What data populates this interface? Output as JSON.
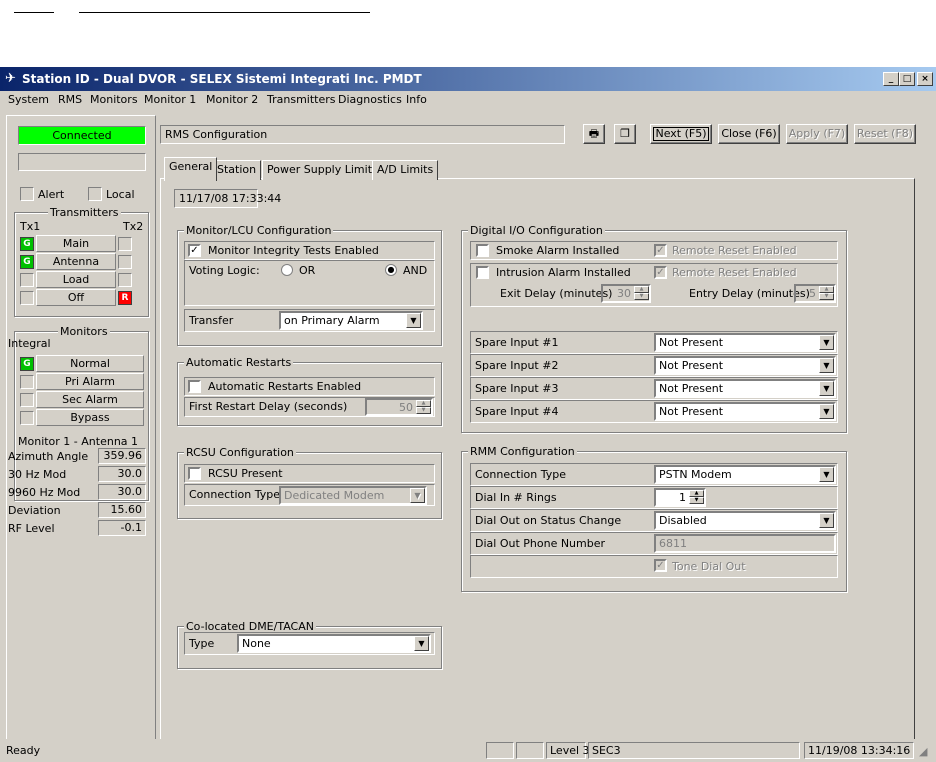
{
  "window": {
    "title": "Station ID - Dual DVOR - SELEX Sistemi Integrati Inc. PMDT",
    "menu": [
      "System",
      "RMS",
      "Monitors",
      "Monitor 1",
      "Monitor 2",
      "Transmitters",
      "Diagnostics",
      "Info"
    ]
  },
  "left": {
    "connection": "Connected",
    "alert": "Alert",
    "local": "Local",
    "transmitters": {
      "title": "Transmitters",
      "tx1": "Tx1",
      "tx2": "Tx2",
      "rows": [
        {
          "label": "Main",
          "tx1": "G",
          "tx2": ""
        },
        {
          "label": "Antenna",
          "tx1": "G",
          "tx2": ""
        },
        {
          "label": "Load",
          "tx1": "",
          "tx2": ""
        },
        {
          "label": "Off",
          "tx1": "",
          "tx2": "R"
        }
      ]
    },
    "monitors": {
      "title": "Monitors",
      "integral": "Integral",
      "rows": [
        {
          "label": "Normal",
          "ind": "G"
        },
        {
          "label": "Pri Alarm",
          "ind": ""
        },
        {
          "label": "Sec Alarm",
          "ind": ""
        },
        {
          "label": "Bypass",
          "ind": ""
        }
      ],
      "subtitle": "Monitor 1 - Antenna 1",
      "readings": [
        {
          "label": "Azimuth Angle",
          "value": "359.96"
        },
        {
          "label": "30 Hz Mod",
          "value": "30.0"
        },
        {
          "label": "9960 Hz Mod",
          "value": "30.0"
        },
        {
          "label": "Deviation",
          "value": "15.60"
        },
        {
          "label": "RF Level",
          "value": "-0.1"
        }
      ]
    }
  },
  "header": {
    "title": "RMS Configuration",
    "buttons": {
      "next": "Next (F5)",
      "close": "Close (F6)",
      "apply": "Apply (F7)",
      "reset": "Reset (F8)"
    }
  },
  "tabs": [
    "General",
    "Station",
    "Power Supply Limits",
    "A/D Limits"
  ],
  "timestamp": "11/17/08 17:33:44",
  "monitor_lcu": {
    "title": "Monitor/LCU Configuration",
    "integrity": "Monitor Integrity Tests Enabled",
    "voting": "Voting Logic:",
    "or": "OR",
    "and": "AND",
    "transfer": "Transfer",
    "transfer_value": "on Primary Alarm"
  },
  "restarts": {
    "title": "Automatic Restarts",
    "enabled": "Automatic Restarts Enabled",
    "delay_label": "First Restart Delay (seconds)",
    "delay_value": "50"
  },
  "rcsu": {
    "title": "RCSU Configuration",
    "present": "RCSU Present",
    "conn_label": "Connection Type",
    "conn_value": "Dedicated Modem"
  },
  "dme": {
    "title": "Co-located DME/TACAN",
    "type_label": "Type",
    "type_value": "None"
  },
  "digital_io": {
    "title": "Digital I/O Configuration",
    "smoke": "Smoke Alarm Installed",
    "remote1": "Remote Reset Enabled",
    "intrusion": "Intrusion Alarm Installed",
    "remote2": "Remote Reset Enabled",
    "exit_label": "Exit Delay (minutes)",
    "exit_value": "30",
    "entry_label": "Entry Delay (minutes)",
    "entry_value": "5",
    "spares": [
      {
        "label": "Spare Input #1",
        "value": "Not Present"
      },
      {
        "label": "Spare Input #2",
        "value": "Not Present"
      },
      {
        "label": "Spare Input #3",
        "value": "Not Present"
      },
      {
        "label": "Spare Input #4",
        "value": "Not Present"
      }
    ]
  },
  "rmm": {
    "title": "RMM Configuration",
    "conn_label": "Connection Type",
    "conn_value": "PSTN Modem",
    "rings_label": "Dial In # Rings",
    "rings_value": "1",
    "dialout_label": "Dial Out on Status Change",
    "dialout_value": "Disabled",
    "phone_label": "Dial Out Phone Number",
    "phone_value": "6811",
    "tone": "Tone Dial Out"
  },
  "status": {
    "ready": "Ready",
    "level": "Level 3",
    "user": "SEC3",
    "datetime": "11/19/08 13:34:16"
  }
}
